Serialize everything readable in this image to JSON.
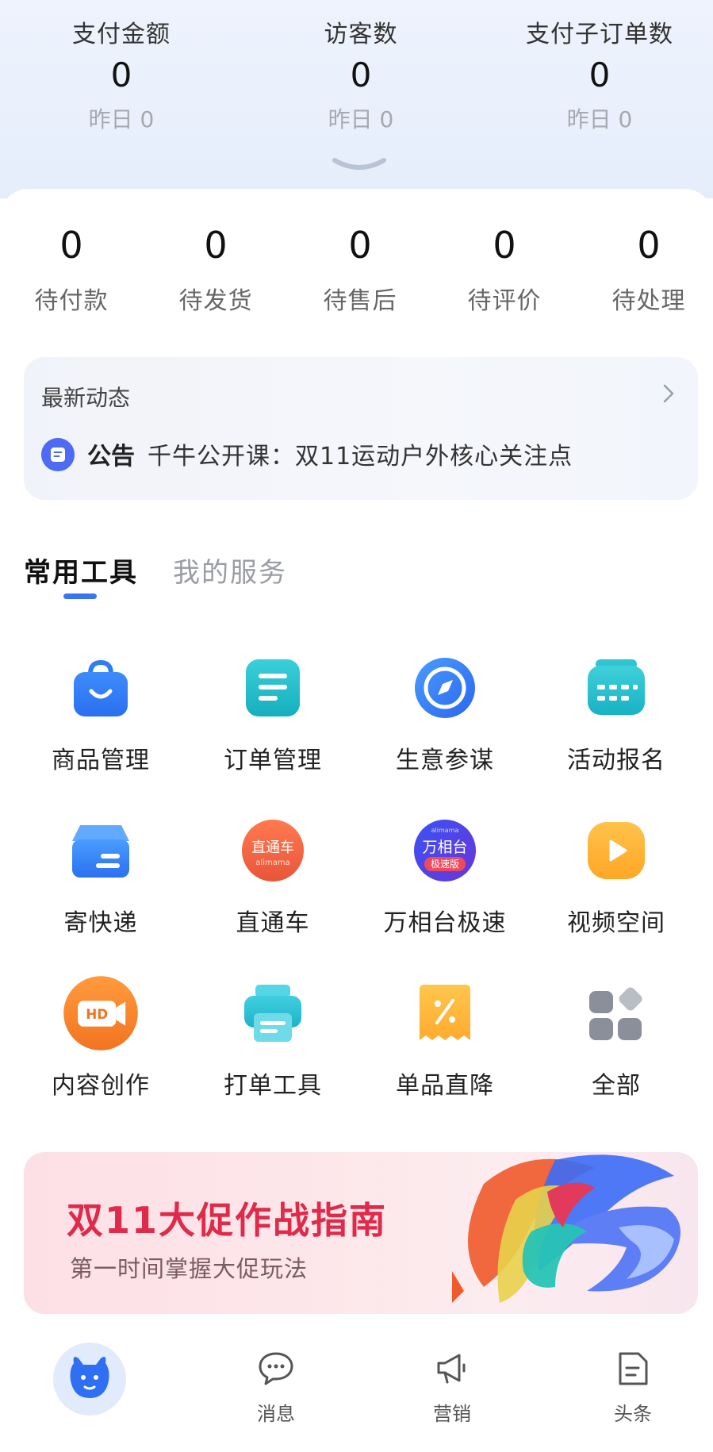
{
  "stats": [
    {
      "label": "支付金额",
      "value": "0",
      "yesterday": "昨日 0"
    },
    {
      "label": "访客数",
      "value": "0",
      "yesterday": "昨日 0"
    },
    {
      "label": "支付子订单数",
      "value": "0",
      "yesterday": "昨日 0"
    }
  ],
  "orders": [
    {
      "value": "0",
      "label": "待付款"
    },
    {
      "value": "0",
      "label": "待发货"
    },
    {
      "value": "0",
      "label": "待售后"
    },
    {
      "value": "0",
      "label": "待评价"
    },
    {
      "value": "0",
      "label": "待处理"
    }
  ],
  "news": {
    "title": "最新动态",
    "tag": "公告",
    "text": "千牛公开课：双11运动户外核心关注点"
  },
  "tabs": {
    "active": "常用工具",
    "inactive": "我的服务"
  },
  "tools": [
    {
      "label": "商品管理",
      "icon": "shopping-bag-icon"
    },
    {
      "label": "订单管理",
      "icon": "order-list-icon"
    },
    {
      "label": "生意参谋",
      "icon": "compass-icon"
    },
    {
      "label": "活动报名",
      "icon": "calendar-icon"
    },
    {
      "label": "寄快递",
      "icon": "package-box-icon"
    },
    {
      "label": "直通车",
      "icon": "ztc-logo-icon",
      "badge": "直通车",
      "badge_sub": "alimama"
    },
    {
      "label": "万相台极速",
      "icon": "wxt-logo-icon",
      "badge": "万相台",
      "badge_sub": "极速版",
      "badge_top": "alimama"
    },
    {
      "label": "视频空间",
      "icon": "play-icon"
    },
    {
      "label": "内容创作",
      "icon": "hd-camera-icon",
      "badge": "HD"
    },
    {
      "label": "打单工具",
      "icon": "printer-icon"
    },
    {
      "label": "单品直降",
      "icon": "percent-coupon-icon"
    },
    {
      "label": "全部",
      "icon": "grid-all-icon"
    }
  ],
  "banner": {
    "title": "双11大促作战指南",
    "subtitle": "第一时间掌握大促玩法"
  },
  "nav": [
    {
      "label": "",
      "icon": "bull-home-icon"
    },
    {
      "label": "消息",
      "icon": "message-icon"
    },
    {
      "label": "营销",
      "icon": "megaphone-icon"
    },
    {
      "label": "头条",
      "icon": "headline-icon"
    }
  ],
  "colors": {
    "accent": "#3b74f0",
    "banner_title": "#e02a4a",
    "top_bg": "#eef3fd"
  }
}
